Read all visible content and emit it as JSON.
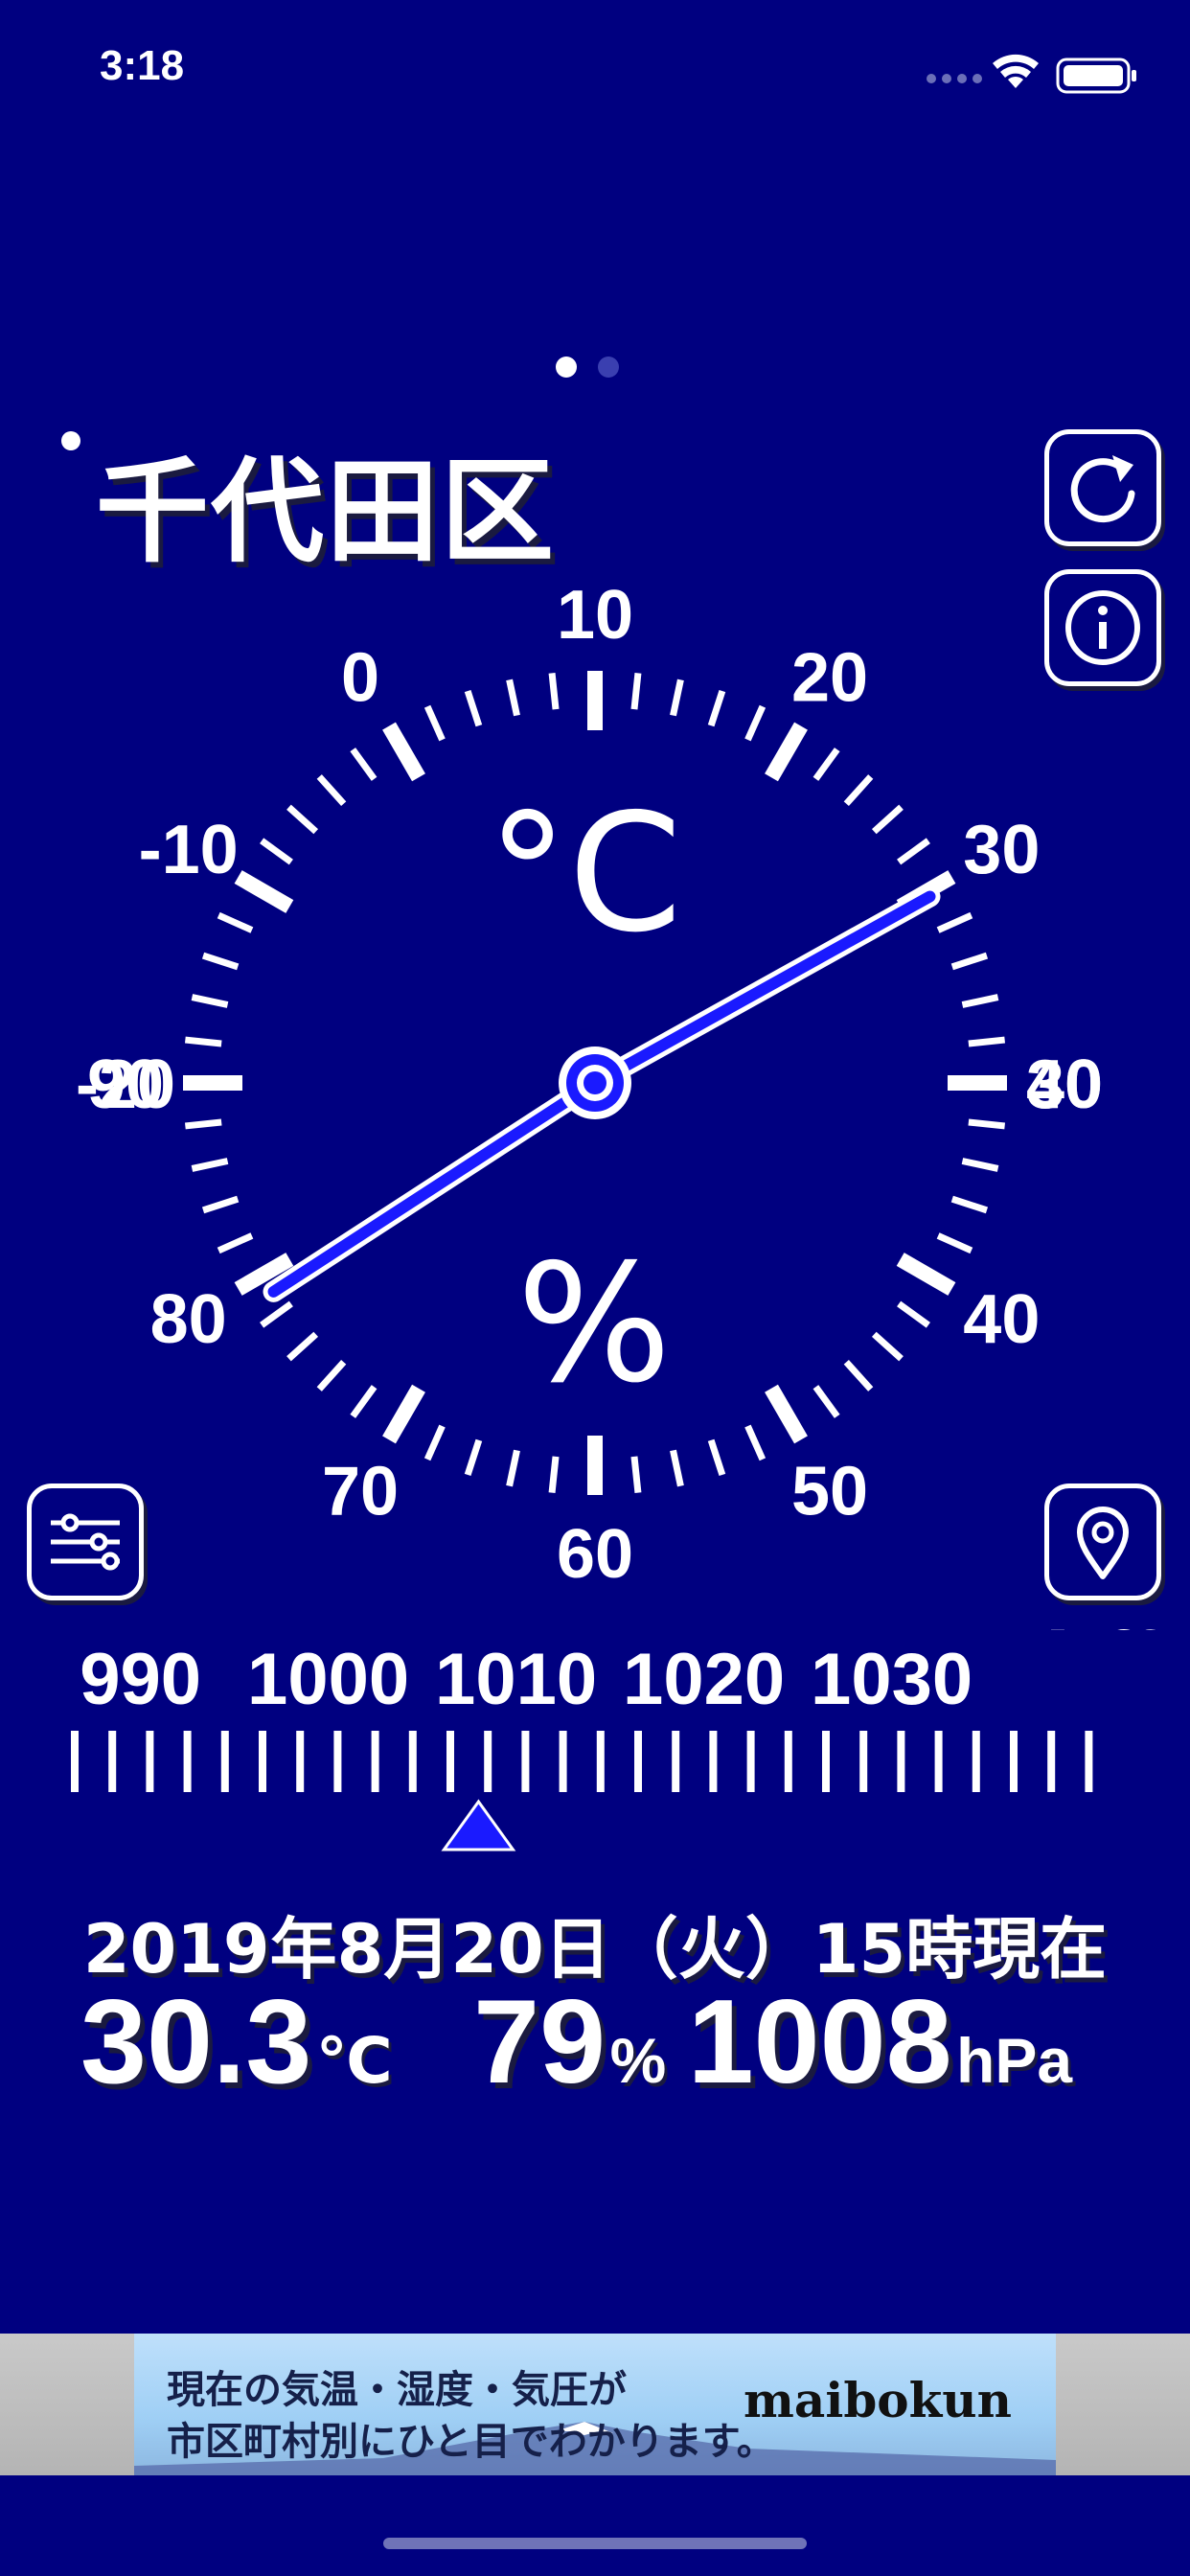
{
  "status_bar": {
    "time": "3:18",
    "wifi_icon": "wifi-icon",
    "battery_icon": "battery-icon"
  },
  "pager": {
    "count": 2,
    "active_index": 0
  },
  "location": {
    "city": "千代田区",
    "icon": "location-dot-icon"
  },
  "buttons": {
    "refresh": "refresh-icon",
    "info": "info-icon",
    "settings": "sliders-icon",
    "location": "map-pin-icon"
  },
  "gauge": {
    "temperature_unit": "°C",
    "humidity_unit": "%",
    "temperature_labels": [
      "-20",
      "-10",
      "0",
      "10",
      "20",
      "30",
      "40"
    ],
    "humidity_labels_left": [
      "90",
      "80",
      "70"
    ],
    "humidity_labels_right": [
      "30",
      "40",
      "50"
    ],
    "humidity_bottom": "60",
    "temperature_value": 30.3,
    "humidity_value": 79,
    "needle_color": "#1a1aff"
  },
  "pressure_scale": {
    "labels": [
      "990",
      "1000",
      "1010",
      "1020",
      "1030"
    ],
    "unit": "hPa",
    "value": 1008,
    "marker_color": "#1a1aff"
  },
  "observation": {
    "datetime": "2019年8月20日（火）15時現在",
    "temperature": "30.3",
    "temperature_unit": "℃",
    "humidity": "79",
    "humidity_unit": "%",
    "pressure": "1008",
    "pressure_unit": "hPa"
  },
  "ad": {
    "line1": "現在の気温・湿度・気圧が",
    "line2": "市区町村別にひと目でわかります。",
    "brand": "maibokun"
  },
  "colors": {
    "background": "#000080",
    "accent": "#1a1aff"
  }
}
